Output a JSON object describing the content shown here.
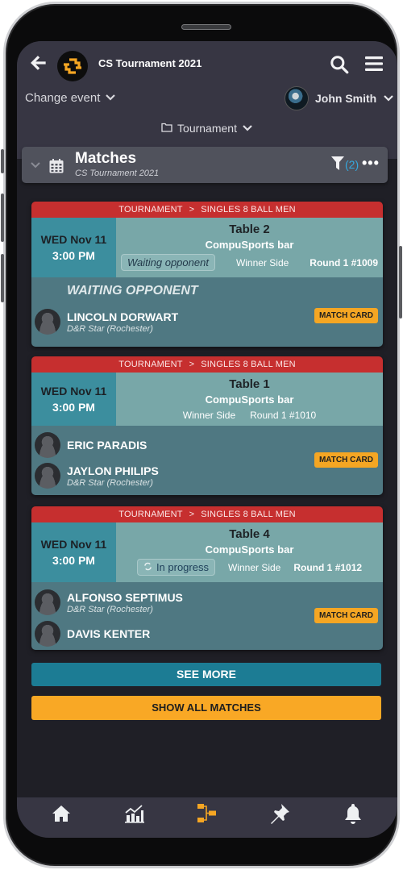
{
  "header": {
    "app_title": "CS Tournament 2021",
    "back_icon": "arrow-left-icon",
    "logo_icon": "cs-logo-icon",
    "search_icon": "search-icon",
    "menu_icon": "hamburger-menu-icon",
    "change_event_label": "Change event",
    "user_name": "John Smith",
    "section_selector_label": "Tournament"
  },
  "matches_panel": {
    "title": "Matches",
    "subtitle": "CS Tournament 2021",
    "filter_count": "(2)",
    "more_label": "•••"
  },
  "matches": [
    {
      "breadcrumb": [
        "TOURNAMENT",
        "SINGLES 8 BALL MEN"
      ],
      "date": "WED Nov 11",
      "time": "3:00 PM",
      "table": "Table 2",
      "venue": "CompuSports bar",
      "status": "Waiting opponent",
      "side": "Winner Side",
      "round": "Round 1 #1009",
      "waiting_label": "WAITING OPPONENT",
      "players": [
        {
          "name": "LINCOLN DORWART",
          "club": "D&R Star (Rochester)"
        }
      ],
      "match_card_label": "MATCH CARD"
    },
    {
      "breadcrumb": [
        "TOURNAMENT",
        "SINGLES 8 BALL MEN"
      ],
      "date": "WED Nov 11",
      "time": "3:00 PM",
      "table": "Table 1",
      "venue": "CompuSports bar",
      "side": "Winner Side",
      "round": "Round 1 #1010",
      "players": [
        {
          "name": "ERIC PARADIS",
          "club": ""
        },
        {
          "name": "JAYLON PHILIPS",
          "club": "D&R Star (Rochester)"
        }
      ],
      "match_card_label": "MATCH CARD"
    },
    {
      "breadcrumb": [
        "TOURNAMENT",
        "SINGLES 8 BALL MEN"
      ],
      "date": "WED Nov 11",
      "time": "3:00 PM",
      "table": "Table 4",
      "venue": "CompuSports bar",
      "status": "In progress",
      "side": "Winner Side",
      "round": "Round 1 #1012",
      "players": [
        {
          "name": "ALFONSO SEPTIMUS",
          "club": "D&R Star (Rochester)"
        },
        {
          "name": "DAVIS KENTER",
          "club": ""
        }
      ],
      "match_card_label": "MATCH CARD"
    }
  ],
  "actions": {
    "see_more": "SEE MORE",
    "show_all": "SHOW ALL MATCHES"
  },
  "bottom_nav": [
    {
      "icon": "home-icon",
      "active": false
    },
    {
      "icon": "stats-chart-icon",
      "active": false
    },
    {
      "icon": "bracket-icon",
      "active": true
    },
    {
      "icon": "pin-icon",
      "active": false
    },
    {
      "icon": "bell-icon",
      "active": false
    }
  ],
  "colors": {
    "accent_orange": "#f5a623",
    "breadcrumb_red": "#c62f2f",
    "date_teal": "#3c8e9e",
    "venue_teal": "#78a7a8",
    "players_teal": "#4f7882",
    "see_more_blue": "#1c7c94",
    "filter_blue": "#35a9de",
    "header_bg": "#373643"
  }
}
